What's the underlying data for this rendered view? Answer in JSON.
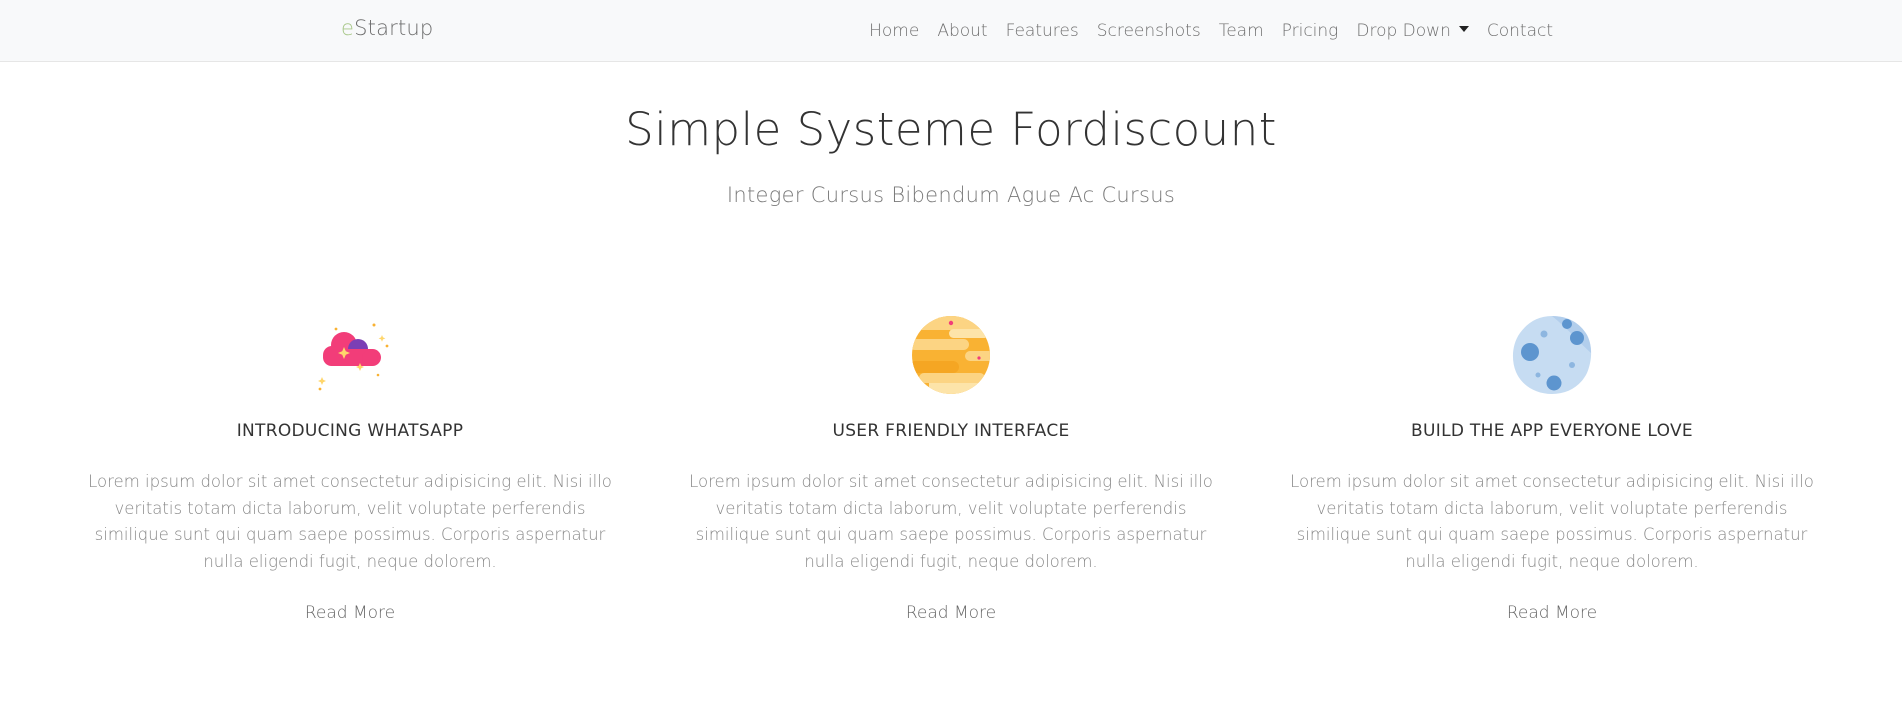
{
  "navbar": {
    "brand_accent": "e",
    "brand_rest": "Startup",
    "links": [
      {
        "label": "Home"
      },
      {
        "label": "About"
      },
      {
        "label": "Features"
      },
      {
        "label": "Screenshots"
      },
      {
        "label": "Team"
      },
      {
        "label": "Pricing"
      },
      {
        "label": "Drop Down"
      },
      {
        "label": "Contact"
      }
    ]
  },
  "hero": {
    "title": "Simple Systeme Fordiscount",
    "subtitle": "Integer Cursus Bibendum Ague Ac Cursus"
  },
  "features": [
    {
      "icon": "cloud-icon",
      "title": "INTRODUCING WHATSAPP",
      "text": "Lorem ipsum dolor sit amet consectetur adipisicing elit. Nisi illo veritatis totam dicta laborum, velit voluptate perferendis similique sunt qui quam saepe possimus. Corporis aspernatur nulla eligendi fugit, neque dolorem.",
      "link": "Read More"
    },
    {
      "icon": "planet-icon",
      "title": "USER FRIENDLY INTERFACE",
      "text": "Lorem ipsum dolor sit amet consectetur adipisicing elit. Nisi illo veritatis totam dicta laborum, velit voluptate perferendis similique sunt qui quam saepe possimus. Corporis aspernatur nulla eligendi fugit, neque dolorem.",
      "link": "Read More"
    },
    {
      "icon": "moon-icon",
      "title": "BUILD THE APP EVERYONE LOVE",
      "text": "Lorem ipsum dolor sit amet consectetur adipisicing elit. Nisi illo veritatis totam dicta laborum, velit voluptate perferendis similique sunt qui quam saepe possimus. Corporis aspernatur nulla eligendi fugit, neque dolorem.",
      "link": "Read More"
    }
  ],
  "colors": {
    "navbar_bg": "#f8f9fa",
    "brand_accent": "#a9c88a",
    "cloud_pink": "#f23d79",
    "planet_orange": "#f9b233",
    "moon_blue": "#5d95cf"
  }
}
